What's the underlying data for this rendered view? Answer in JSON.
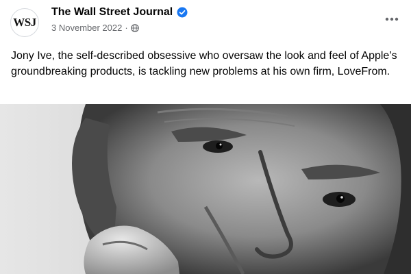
{
  "post": {
    "author": {
      "name": "The Wall Street Journal",
      "avatar_text": "WSJ",
      "verified": true
    },
    "date": "3 November 2022",
    "separator": "·",
    "audience_icon": "globe-icon",
    "more_icon": "more-options-icon",
    "caption": "Jony Ive, the self-described obsessive who oversaw the look and feel of Apple’s groundbreaking products, is tackling new problems at his own firm, LoveFrom.",
    "photo": {
      "description_icon": "portrait-photo",
      "style": "black-and-white close-up portrait"
    }
  },
  "colors": {
    "text_primary": "#050505",
    "text_secondary": "#65676b",
    "verified_blue": "#1877f2",
    "background": "#ffffff"
  }
}
